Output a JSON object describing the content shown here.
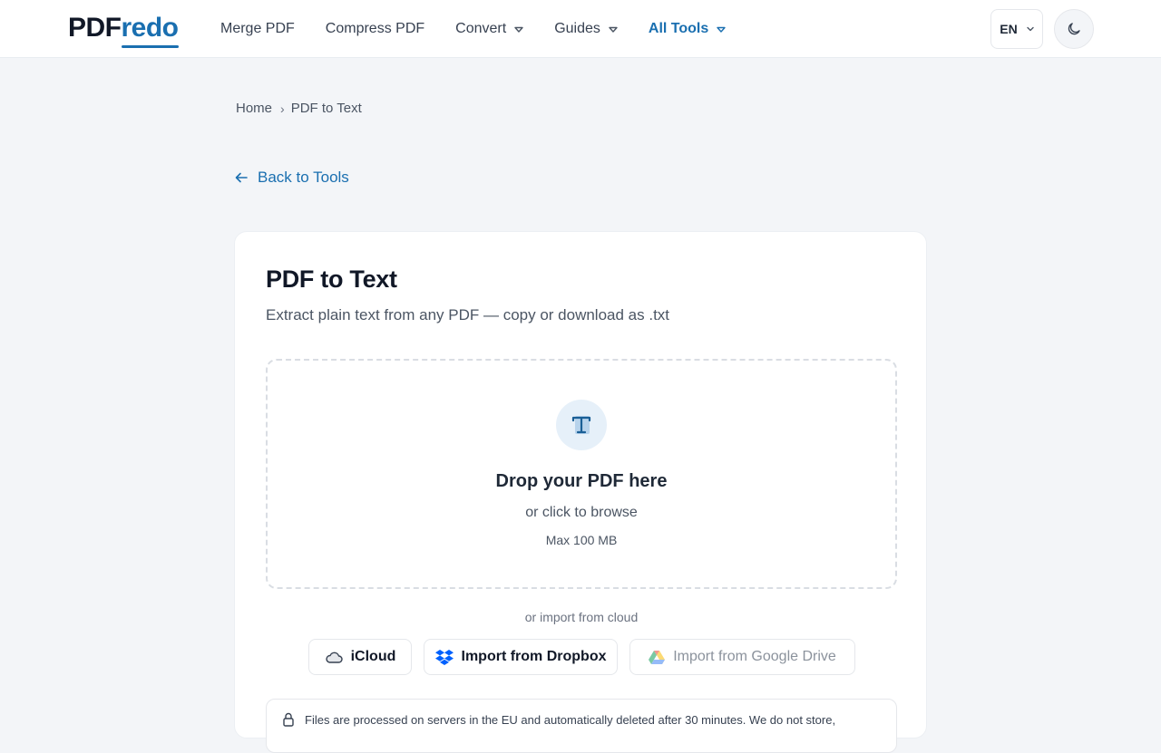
{
  "brand": {
    "part1": "PDF",
    "part2": "redo",
    "accent_color": "#1a6fb0"
  },
  "nav": {
    "items": [
      {
        "label": "Merge PDF",
        "dropdown": false,
        "active": false
      },
      {
        "label": "Compress PDF",
        "dropdown": false,
        "active": false
      },
      {
        "label": "Convert",
        "dropdown": true,
        "active": false
      },
      {
        "label": "Guides",
        "dropdown": true,
        "active": false
      },
      {
        "label": "All Tools",
        "dropdown": true,
        "active": true
      }
    ],
    "language": "EN",
    "theme_icon": "moon-icon"
  },
  "breadcrumb": {
    "home": "Home",
    "separator": "›",
    "current": "PDF to Text"
  },
  "back_link": "Back to Tools",
  "tool": {
    "title": "PDF to Text",
    "subtitle": "Extract plain text from any PDF — copy or download as .txt"
  },
  "dropzone": {
    "icon": "text-format-icon",
    "title": "Drop your PDF here",
    "browse": "or click to browse",
    "max_size": "Max 100 MB"
  },
  "cloud": {
    "label": "or import from cloud",
    "icloud": "iCloud",
    "dropbox": "Import from Dropbox",
    "google_drive": "Import from Google Drive"
  },
  "notice": {
    "text": "Files are processed on servers in the EU and automatically deleted after 30 minutes. We do not store,"
  }
}
